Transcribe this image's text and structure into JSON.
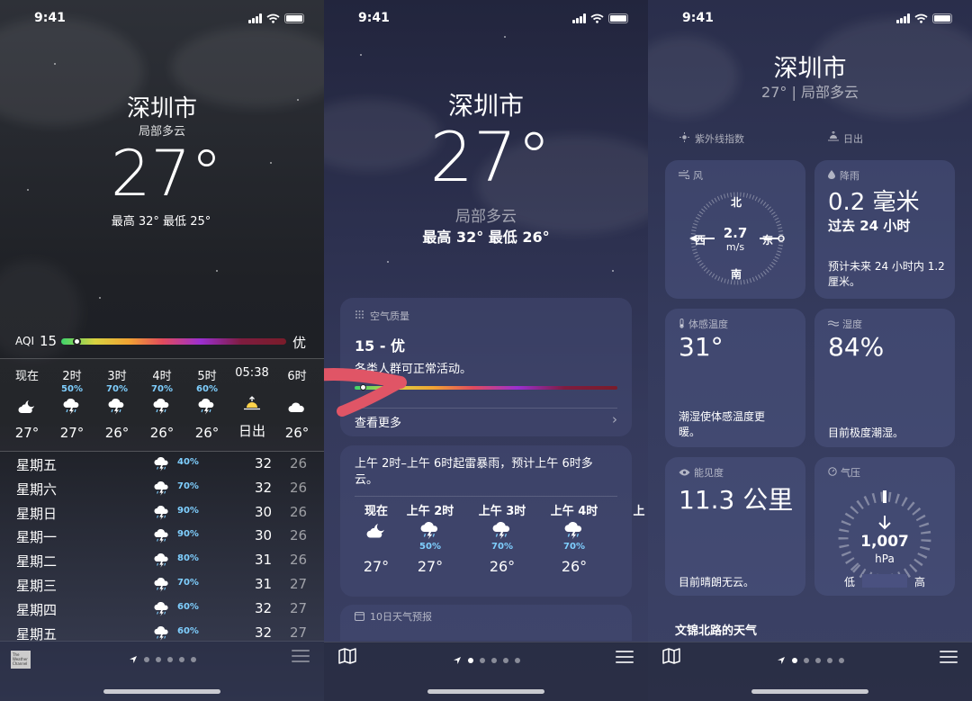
{
  "status": {
    "time": "9:41"
  },
  "panel1": {
    "city": "深圳市",
    "condition": "局部多云",
    "temp": "27°",
    "hilo": "最高 32°  最低 25°",
    "aqi_label": "AQI",
    "aqi_value": "15",
    "aqi_grade": "优",
    "hourly": [
      {
        "time": "现在",
        "pct": "",
        "temp": "27°",
        "icon": "partly-cloudy-night-icon"
      },
      {
        "time": "2时",
        "pct": "50%",
        "temp": "27°",
        "icon": "thunderstorm-icon"
      },
      {
        "time": "3时",
        "pct": "70%",
        "temp": "26°",
        "icon": "thunderstorm-icon"
      },
      {
        "time": "4时",
        "pct": "70%",
        "temp": "26°",
        "icon": "thunderstorm-icon"
      },
      {
        "time": "5时",
        "pct": "60%",
        "temp": "26°",
        "icon": "thunderstorm-icon"
      },
      {
        "time": "05:38",
        "pct": "",
        "temp": "日出",
        "icon": "sunrise-icon"
      },
      {
        "time": "6时",
        "pct": "",
        "temp": "26°",
        "icon": "cloud-icon"
      }
    ],
    "daily": [
      {
        "day": "星期五",
        "pct": "40%",
        "hi": "32",
        "lo": "26"
      },
      {
        "day": "星期六",
        "pct": "70%",
        "hi": "32",
        "lo": "26"
      },
      {
        "day": "星期日",
        "pct": "90%",
        "hi": "30",
        "lo": "26"
      },
      {
        "day": "星期一",
        "pct": "90%",
        "hi": "30",
        "lo": "26"
      },
      {
        "day": "星期二",
        "pct": "80%",
        "hi": "31",
        "lo": "26"
      },
      {
        "day": "星期三",
        "pct": "70%",
        "hi": "31",
        "lo": "27"
      },
      {
        "day": "星期四",
        "pct": "60%",
        "hi": "32",
        "lo": "27"
      },
      {
        "day": "星期五",
        "pct": "60%",
        "hi": "32",
        "lo": "27"
      }
    ],
    "logo_text": "The Weather Channel"
  },
  "panel2": {
    "city": "深圳市",
    "temp": "27°",
    "condition": "局部多云",
    "hilo": "最高 32°  最低 26°",
    "aq_title": "空气质量",
    "aq_value": "15 - 优",
    "aq_desc": "各类人群可正常活动。",
    "aq_more": "查看更多",
    "forecast_text": "上午 2时–上午 6时起雷暴雨，预计上午 6时多云。",
    "hourly": [
      {
        "time": "现在",
        "pct": "",
        "temp": "27°",
        "icon": "partly-cloudy-night-icon"
      },
      {
        "time": "上午 2时",
        "pct": "50%",
        "temp": "27°",
        "icon": "thunderstorm-icon"
      },
      {
        "time": "上午 3时",
        "pct": "70%",
        "temp": "26°",
        "icon": "thunderstorm-icon"
      },
      {
        "time": "上午 4时",
        "pct": "70%",
        "temp": "26°",
        "icon": "thunderstorm-icon"
      },
      {
        "time": "上",
        "pct": "",
        "temp": "",
        "icon": ""
      }
    ],
    "ten_day_title": "10日天气预报"
  },
  "panel3": {
    "city": "深圳市",
    "subtitle": "27° | 局部多云",
    "uv_title": "紫外线指数",
    "sunrise_title": "日出",
    "wind": {
      "title": "风",
      "n": "北",
      "s": "南",
      "w": "西",
      "e": "东",
      "speed": "2.7",
      "unit": "m/s"
    },
    "rain": {
      "title": "降雨",
      "value": "0.2 毫米",
      "sub": "过去 24 小时",
      "desc": "预计未来 24 小时内 1.2 厘米。"
    },
    "feels": {
      "title": "体感温度",
      "value": "31°",
      "desc": "潮湿使体感温度更暖。"
    },
    "humidity": {
      "title": "湿度",
      "value": "84%",
      "desc": "目前极度潮湿。"
    },
    "visibility": {
      "title": "能见度",
      "value": "11.3 公里",
      "desc": "目前晴朗无云。"
    },
    "pressure": {
      "title": "气压",
      "value": "1,007",
      "unit": "hPa",
      "low": "低",
      "high": "高"
    },
    "bottom_text": "文锦北路的天气"
  },
  "colors": {
    "rain_pct": "#7fcfff",
    "arrow": "#e05566"
  }
}
